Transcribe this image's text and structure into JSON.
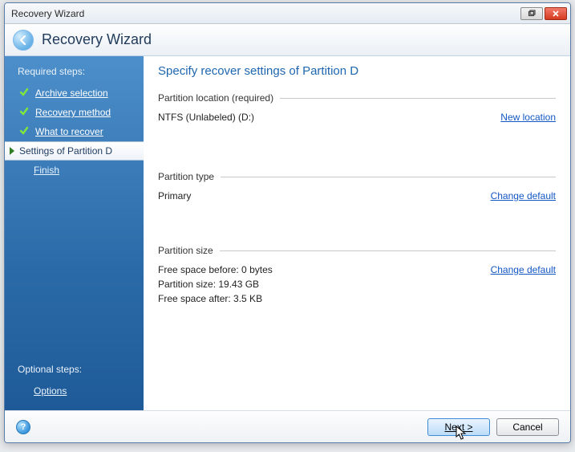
{
  "titlebar": {
    "text": "Recovery Wizard"
  },
  "header": {
    "title": "Recovery Wizard"
  },
  "sidebar": {
    "required_label": "Required steps:",
    "optional_label": "Optional steps:",
    "steps": [
      {
        "label": "Archive selection",
        "done": true
      },
      {
        "label": "Recovery method",
        "done": true
      },
      {
        "label": "What to recover",
        "done": true
      },
      {
        "label": "Settings of Partition D",
        "active": true
      },
      {
        "label": "Finish"
      }
    ],
    "optional_steps": [
      {
        "label": "Options"
      }
    ]
  },
  "content": {
    "title": "Specify recover settings of Partition D",
    "location": {
      "header": "Partition location (required)",
      "value": "NTFS (Unlabeled) (D:)",
      "link": "New location"
    },
    "type": {
      "header": "Partition type",
      "value": "Primary",
      "link": "Change default"
    },
    "size": {
      "header": "Partition size",
      "free_before": "Free space before: 0 bytes",
      "size": "Partition size: 19.43 GB",
      "free_after": "Free space after: 3.5 KB",
      "link": "Change default"
    }
  },
  "footer": {
    "next": "Next >",
    "cancel": "Cancel"
  }
}
